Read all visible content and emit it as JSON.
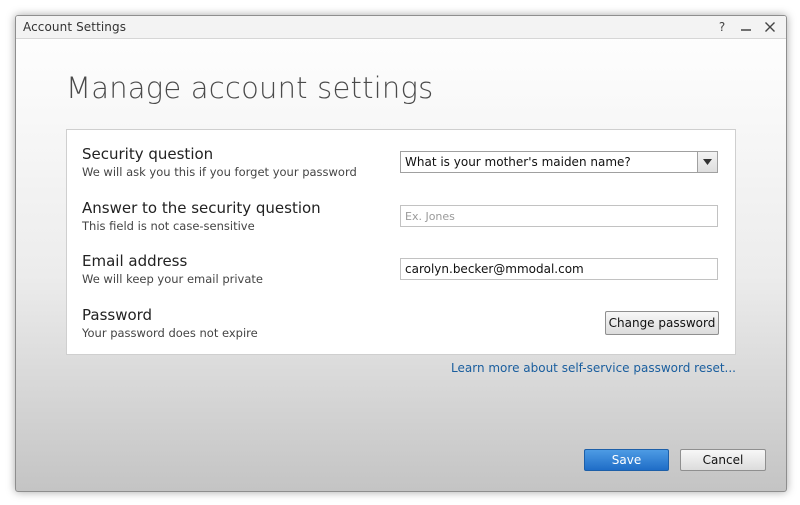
{
  "window": {
    "title": "Account Settings",
    "help_symbol": "?",
    "minimize_symbol": "—",
    "close_symbol": "✕"
  },
  "page": {
    "title": "Manage account settings"
  },
  "settings": {
    "security_question": {
      "label": "Security question",
      "description": "We will ask you this if you forget your password",
      "selected": "What is your mother's maiden name?"
    },
    "answer": {
      "label": "Answer to the security question",
      "description": "This field is not case-sensitive",
      "placeholder": "Ex. Jones",
      "value": ""
    },
    "email": {
      "label": "Email address",
      "description": "We will keep your email private",
      "value": "carolyn.becker@mmodal.com"
    },
    "password": {
      "label": "Password",
      "description": "Your password does not expire",
      "button_label": "Change password"
    }
  },
  "learn_more_link": "Learn more about self-service password reset...",
  "footer": {
    "save_label": "Save",
    "cancel_label": "Cancel"
  },
  "colors": {
    "primary_button": "#2a78d0",
    "link": "#1a5e9e"
  }
}
